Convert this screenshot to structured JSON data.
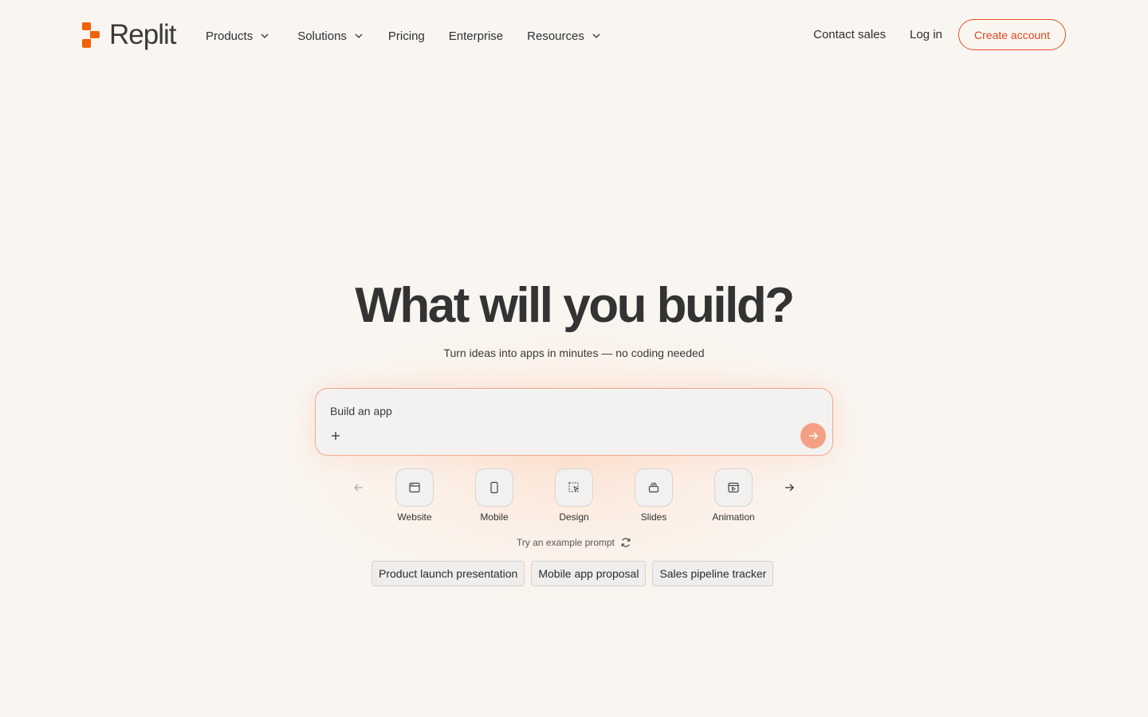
{
  "header": {
    "logo_text": "Replit",
    "nav": [
      {
        "label": "Products",
        "has_dropdown": true
      },
      {
        "label": "Solutions",
        "has_dropdown": true
      },
      {
        "label": "Pricing",
        "has_dropdown": false
      },
      {
        "label": "Enterprise",
        "has_dropdown": false
      },
      {
        "label": "Resources",
        "has_dropdown": true
      }
    ],
    "contact_sales": "Contact sales",
    "log_in": "Log in",
    "create_account": "Create account"
  },
  "hero": {
    "title": "What will you build?",
    "subtitle": "Turn ideas into apps in minutes — no coding needed"
  },
  "prompt": {
    "placeholder": "Build an app",
    "attach_icon": "plus-icon",
    "send_icon": "arrow-right-icon"
  },
  "categories": [
    {
      "label": "Website",
      "icon": "browser-window-icon"
    },
    {
      "label": "Mobile",
      "icon": "phone-icon"
    },
    {
      "label": "Design",
      "icon": "cursor-select-icon"
    },
    {
      "label": "Slides",
      "icon": "slides-stack-icon"
    },
    {
      "label": "Animation",
      "icon": "video-window-icon"
    }
  ],
  "example": {
    "label": "Try an example prompt",
    "chips": [
      "Product launch presentation",
      "Mobile app proposal",
      "Sales pipeline tracker"
    ]
  },
  "colors": {
    "accent": "#e8501f",
    "send_button": "#f5a085",
    "background": "#f9f6f2"
  }
}
